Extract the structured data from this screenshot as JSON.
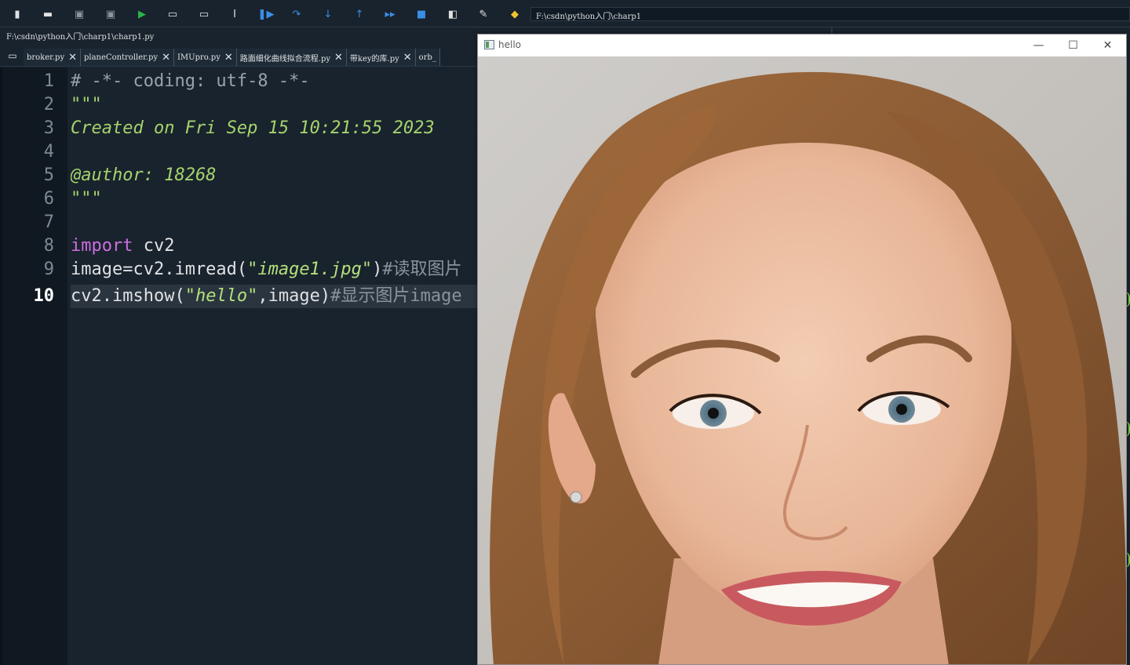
{
  "toolbar": {
    "buttons": [
      {
        "name": "new-file-icon",
        "glyph": "▮",
        "color": "#e0e1e3"
      },
      {
        "name": "open-file-icon",
        "glyph": "▬",
        "color": "#e0e1e3"
      },
      {
        "name": "save-icon",
        "glyph": "▣",
        "color": "#8a96a3"
      },
      {
        "name": "save-all-icon",
        "glyph": "▣",
        "color": "#8a96a3"
      },
      {
        "name": "run-icon",
        "glyph": "▶",
        "color": "#2ab34a"
      },
      {
        "name": "run-cell-icon",
        "glyph": "▭",
        "color": "#e0e1e3"
      },
      {
        "name": "run-cell-advance-icon",
        "glyph": "▭",
        "color": "#e0e1e3"
      },
      {
        "name": "run-selection-icon",
        "glyph": "I",
        "color": "#e0e1e3"
      },
      {
        "name": "debug-icon",
        "glyph": "❚▶",
        "color": "#3a8ee6"
      },
      {
        "name": "step-over-icon",
        "glyph": "↷",
        "color": "#3a8ee6"
      },
      {
        "name": "step-into-icon",
        "glyph": "↓",
        "color": "#3a8ee6"
      },
      {
        "name": "step-return-icon",
        "glyph": "↑",
        "color": "#3a8ee6"
      },
      {
        "name": "continue-icon",
        "glyph": "▸▸",
        "color": "#3a8ee6"
      },
      {
        "name": "stop-icon",
        "glyph": "■",
        "color": "#3a8ee6"
      },
      {
        "name": "maximize-pane-icon",
        "glyph": "◧",
        "color": "#e0e1e3"
      },
      {
        "name": "preferences-wrench-icon",
        "glyph": "✎",
        "color": "#e0e1e3"
      },
      {
        "name": "python-path-icon",
        "glyph": "◆",
        "color": "#f2c230"
      }
    ],
    "working_dir": "F:\\csdn\\python入门\\charp1"
  },
  "editor": {
    "file_path": "F:\\csdn\\python入门\\charp1\\charp1.py",
    "tabs": [
      {
        "label": "broker.py"
      },
      {
        "label": "planeController.py"
      },
      {
        "label": "IMUpro.py"
      },
      {
        "label": "路面细化曲线拟合流程.py"
      },
      {
        "label": "带key的库.py"
      },
      {
        "label": "orb_"
      }
    ],
    "close_glyph": "✕",
    "browse_tabs_glyph": "▭",
    "current_line": "10",
    "lines": [
      {
        "n": "1",
        "segments": [
          {
            "t": "# -*- coding: utf-8 -*-",
            "c": "comment"
          }
        ]
      },
      {
        "n": "2",
        "segments": [
          {
            "t": "\"\"\"",
            "c": "docstr"
          }
        ]
      },
      {
        "n": "3",
        "segments": [
          {
            "t": "Created on Fri Sep 15 10:21:55 2023",
            "c": "docstr"
          }
        ]
      },
      {
        "n": "4",
        "segments": []
      },
      {
        "n": "5",
        "segments": [
          {
            "t": "@author: 18268",
            "c": "docstr"
          }
        ]
      },
      {
        "n": "6",
        "segments": [
          {
            "t": "\"\"\"",
            "c": "docstr"
          }
        ]
      },
      {
        "n": "7",
        "segments": []
      },
      {
        "n": "8",
        "segments": [
          {
            "t": "import",
            "c": "kw"
          },
          {
            "t": " cv2",
            "c": ""
          }
        ]
      },
      {
        "n": "9",
        "segments": [
          {
            "t": "image=cv2.imread(",
            "c": ""
          },
          {
            "t": "\"image1.jpg\"",
            "c": "str"
          },
          {
            "t": ")",
            "c": ""
          },
          {
            "t": "#读取图片",
            "c": "cjk"
          }
        ]
      },
      {
        "n": "10",
        "segments": [
          {
            "t": "cv2.imshow(",
            "c": ""
          },
          {
            "t": "\"hello\"",
            "c": "str"
          },
          {
            "t": ",image)",
            "c": ""
          },
          {
            "t": "#显示图片image",
            "c": "cjk"
          }
        ]
      }
    ]
  },
  "hello_window": {
    "title": "hello",
    "minimize_glyph": "—",
    "maximize_glyph": "☐",
    "close_glyph": "✕"
  },
  "colors": {
    "editor_bg": "#19232d",
    "keyword": "#cc6ee0",
    "string": "#b3e07c",
    "docstring": "#a5d36d",
    "comment": "#9aa3ad"
  }
}
